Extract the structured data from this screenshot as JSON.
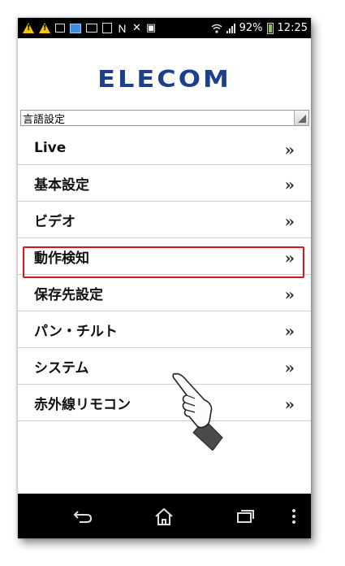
{
  "status_bar": {
    "battery_percent": "92%",
    "time": "12:25",
    "icons": [
      "warning-icon",
      "warning-icon",
      "screenshot-icon",
      "app-icon",
      "gallery-icon",
      "clipboard-icon",
      "nfc-icon",
      "vibrate-icon",
      "data-icon",
      "wifi-icon",
      "signal-icon",
      "battery-icon"
    ]
  },
  "header": {
    "logo_text": "ELECOM"
  },
  "language": {
    "label": "言語設定"
  },
  "menu": {
    "items": [
      {
        "label": "Live",
        "arrow": "»"
      },
      {
        "label": "基本設定",
        "arrow": "»"
      },
      {
        "label": "ビデオ",
        "arrow": "»"
      },
      {
        "label": "動作検知",
        "arrow": "»"
      },
      {
        "label": "保存先設定",
        "arrow": "»"
      },
      {
        "label": "パン・チルト",
        "arrow": "»"
      },
      {
        "label": "システム",
        "arrow": "»"
      },
      {
        "label": "赤外線リモコン",
        "arrow": "»"
      }
    ],
    "highlighted_item": "システム",
    "highlight_color": "#d9151b"
  },
  "navigation": {
    "buttons": [
      "back-icon",
      "home-icon",
      "recent-apps-icon",
      "menu-icon"
    ]
  },
  "colors": {
    "logo": "#1d3f8f",
    "status_bar": "#000000",
    "nav_bar": "#000000"
  }
}
